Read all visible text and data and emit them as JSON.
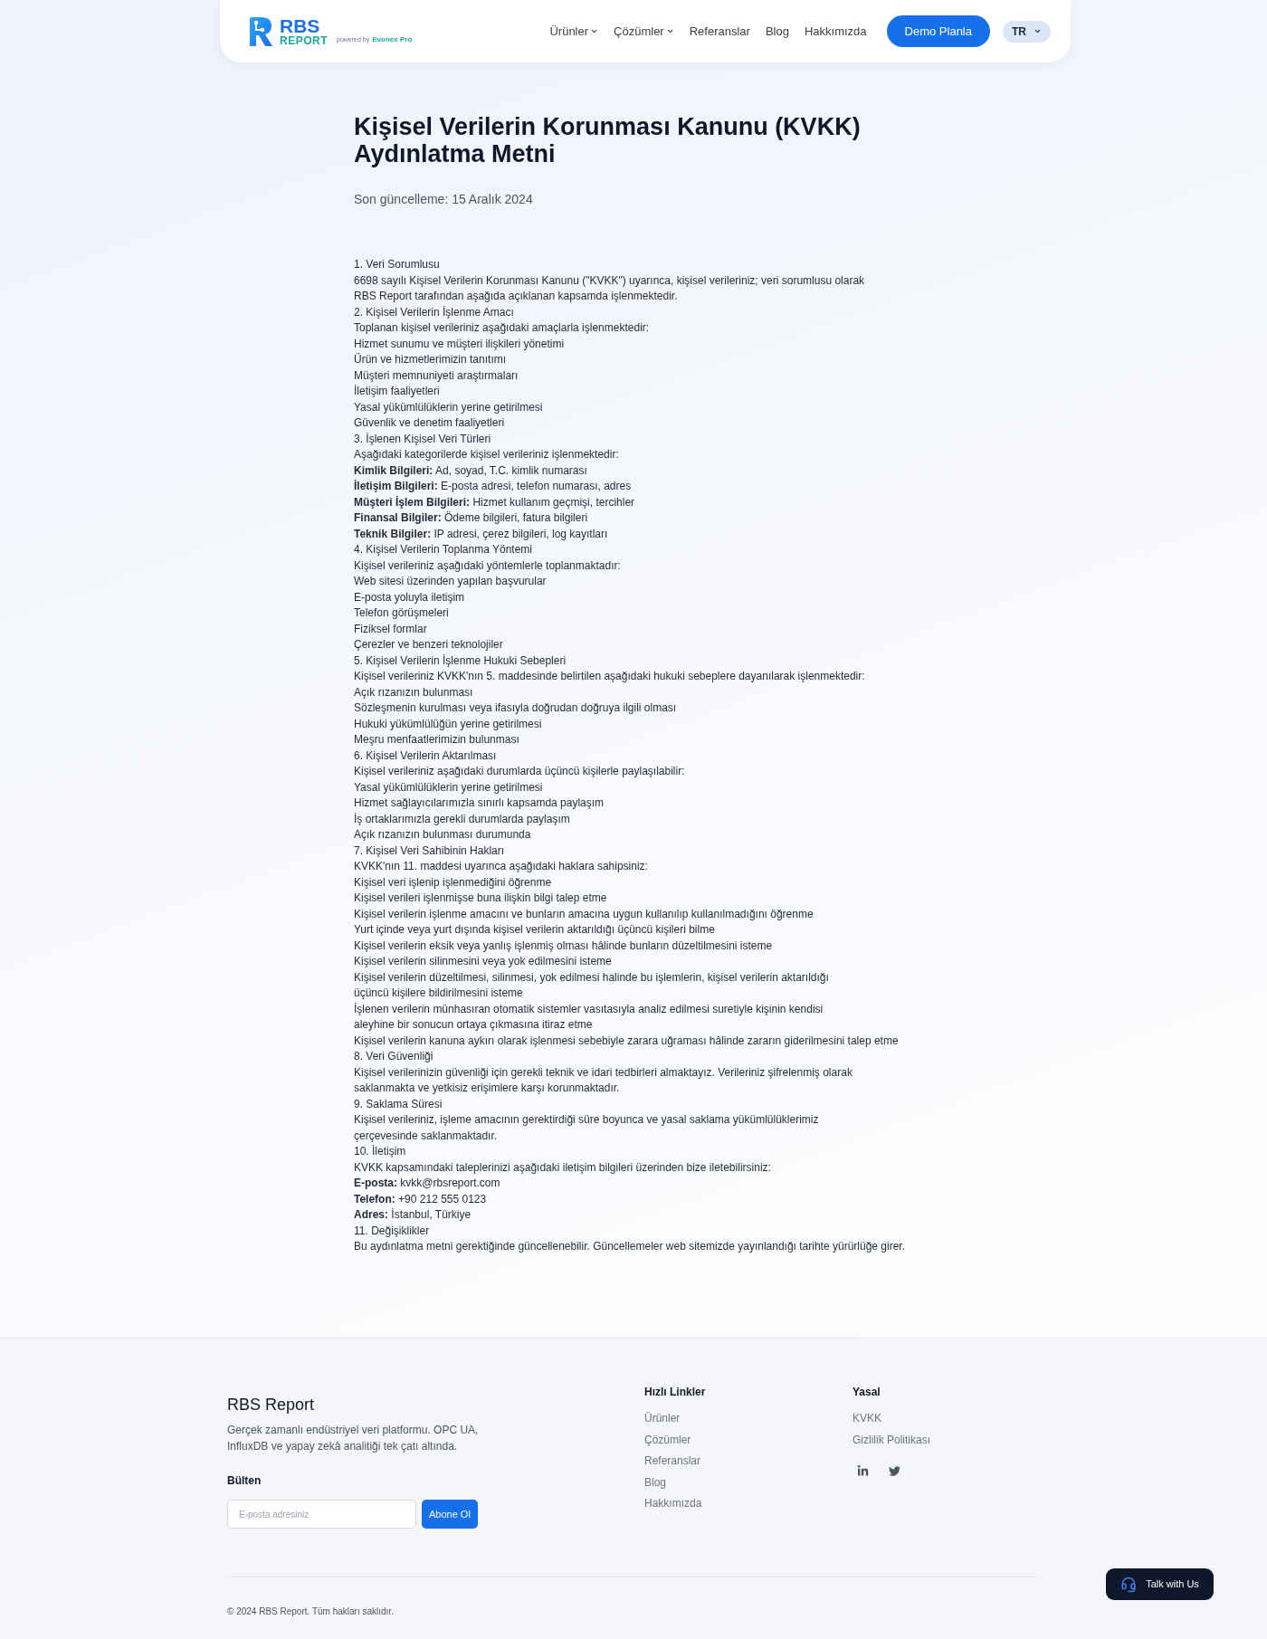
{
  "header": {
    "logo": {
      "name": "RBS",
      "sub": "REPORT",
      "powered_by": "powered by",
      "powered_brand": "Evonex Pro"
    },
    "nav": [
      {
        "label": "Ürünler",
        "dropdown": true
      },
      {
        "label": "Çözümler",
        "dropdown": true
      },
      {
        "label": "Referanslar",
        "dropdown": false
      },
      {
        "label": "Blog",
        "dropdown": false
      },
      {
        "label": "Hakkımızda",
        "dropdown": false
      }
    ],
    "cta": "Demo Planla",
    "language": "TR"
  },
  "page": {
    "title": "Kişisel Verilerin Korunması Kanunu (KVKK) Aydınlatma Metni",
    "updated": "Son güncelleme: 15 Aralık 2024",
    "body_lines": [
      "1. Veri Sorumlusu",
      "6698 sayılı Kişisel Verilerin Korunması Kanunu (\"KVKK\") uyarınca, kişisel verileriniz; veri sorumlusu olarak",
      "RBS Report tarafından aşağıda açıklanan kapsamda işlenmektedir.",
      "2. Kişisel Verilerin İşlenme Amacı",
      "Toplanan kişisel verileriniz aşağıdaki amaçlarla işlenmektedir:",
      "Hizmet sunumu ve müşteri ilişkileri yönetimi",
      "Ürün ve hizmetlerimizin tanıtımı",
      "Müşteri memnuniyeti araştırmaları",
      "İletişim faaliyetleri",
      "Yasal yükümlülüklerin yerine getirilmesi",
      "Güvenlik ve denetim faaliyetleri",
      "3. İşlenen Kişisel Veri Türleri",
      "Aşağıdaki kategorilerde kişisel verileriniz işlenmektedir:",
      "**Kimlik Bilgileri:** Ad, soyad, T.C. kimlik numarası",
      "**İletişim Bilgileri:** E-posta adresi, telefon numarası, adres",
      "**Müşteri İşlem Bilgileri:** Hizmet kullanım geçmişi, tercihler",
      "**Finansal Bilgiler:** Ödeme bilgileri, fatura bilgileri",
      "**Teknik Bilgiler:** IP adresi, çerez bilgileri, log kayıtları",
      "4. Kişisel Verilerin Toplanma Yöntemi",
      "Kişisel verileriniz aşağıdaki yöntemlerle toplanmaktadır:",
      "Web sitesi üzerinden yapılan başvurular",
      "E-posta yoluyla iletişim",
      "Telefon görüşmeleri",
      "Fiziksel formlar",
      "Çerezler ve benzeri teknolojiler",
      "5. Kişisel Verilerin İşlenme Hukuki Sebepleri",
      "Kişisel verileriniz KVKK'nın 5. maddesinde belirtilen aşağıdaki hukuki sebeplere dayanılarak işlenmektedir:",
      "Açık rızanızın bulunması",
      "Sözleşmenin kurulması veya ifasıyla doğrudan doğruya ilgili olması",
      "Hukuki yükümlülüğün yerine getirilmesi",
      "Meşru menfaatlerimizin bulunması",
      "6. Kişisel Verilerin Aktarılması",
      "Kişisel verileriniz aşağıdaki durumlarda üçüncü kişilerle paylaşılabilir:",
      "Yasal yükümlülüklerin yerine getirilmesi",
      "Hizmet sağlayıcılarımızla sınırlı kapsamda paylaşım",
      "İş ortaklarımızla gerekli durumlarda paylaşım",
      "Açık rızanızın bulunması durumunda",
      "7. Kişisel Veri Sahibinin Hakları",
      "KVKK'nın 11. maddesi uyarınca aşağıdaki haklara sahipsiniz:",
      "Kişisel veri işlenip işlenmediğini öğrenme",
      "Kişisel verileri işlenmişse buna ilişkin bilgi talep etme",
      "Kişisel verilerin işlenme amacını ve bunların amacına uygun kullanılıp kullanılmadığını öğrenme",
      "Yurt içinde veya yurt dışında kişisel verilerin aktarıldığı üçüncü kişileri bilme",
      "Kişisel verilerin eksik veya yanlış işlenmiş olması hâlinde bunların düzeltilmesini isteme",
      "Kişisel verilerin silinmesini veya yok edilmesini isteme",
      "Kişisel verilerin düzeltilmesi, silinmesi, yok edilmesi halinde bu işlemlerin, kişisel verilerin aktarıldığı",
      "üçüncü kişilere bildirilmesini isteme",
      "İşlenen verilerin münhasıran otomatik sistemler vasıtasıyla analiz edilmesi suretiyle kişinin kendisi",
      "aleyhine bir sonucun ortaya çıkmasına itiraz etme",
      "Kişisel verilerin kanuna aykırı olarak işlenmesi sebebiyle zarara uğraması hâlinde zararın giderilmesini talep etme",
      "8. Veri Güvenliği",
      "Kişisel verilerinizin güvenliği için gerekli teknik ve idari tedbirleri almaktayız. Verileriniz şifrelenmiş olarak",
      "saklanmakta ve yetkisiz erişimlere karşı korunmaktadır.",
      "9. Saklama Süresi",
      "Kişisel verileriniz, işleme amacının gerektirdiği süre boyunca ve yasal saklama yükümlülüklerimiz",
      "çerçevesinde saklanmaktadır.",
      "10. İletişim",
      "KVKK kapsamındaki taleplerinizi aşağıdaki iletişim bilgileri üzerinden bize iletebilirsiniz:",
      "**E-posta:** kvkk@rbsreport.com",
      "**Telefon:** +90 212 555 0123",
      "**Adres:** İstanbul, Türkiye",
      "11. Değişiklikler",
      "Bu aydınlatma metni gerektiğinde güncellenebilir. Güncellemeler web sitemizde yayınlandığı tarihte yürürlüğe girer."
    ]
  },
  "footer": {
    "brand": "RBS Report",
    "description": "Gerçek zamanlı endüstriyel veri platformu. OPC UA, InfluxDB ve yapay zekâ analitiği tek çatı altında.",
    "newsletter": {
      "title": "Bülten",
      "placeholder": "E-posta adresiniz",
      "button": "Abone Ol"
    },
    "quick_links": {
      "title": "Hızlı Linkler",
      "items": [
        "Ürünler",
        "Çözümler",
        "Referanslar",
        "Blog",
        "Hakkımızda"
      ]
    },
    "legal": {
      "title": "Yasal",
      "items": [
        "KVKK",
        "Gizlilik Politikası"
      ]
    },
    "social": [
      {
        "kind": "linkedin"
      },
      {
        "kind": "twitter"
      }
    ],
    "copyright": "© 2024 RBS Report. Tüm hakları saklıdır."
  },
  "chat_button": "Talk with Us"
}
